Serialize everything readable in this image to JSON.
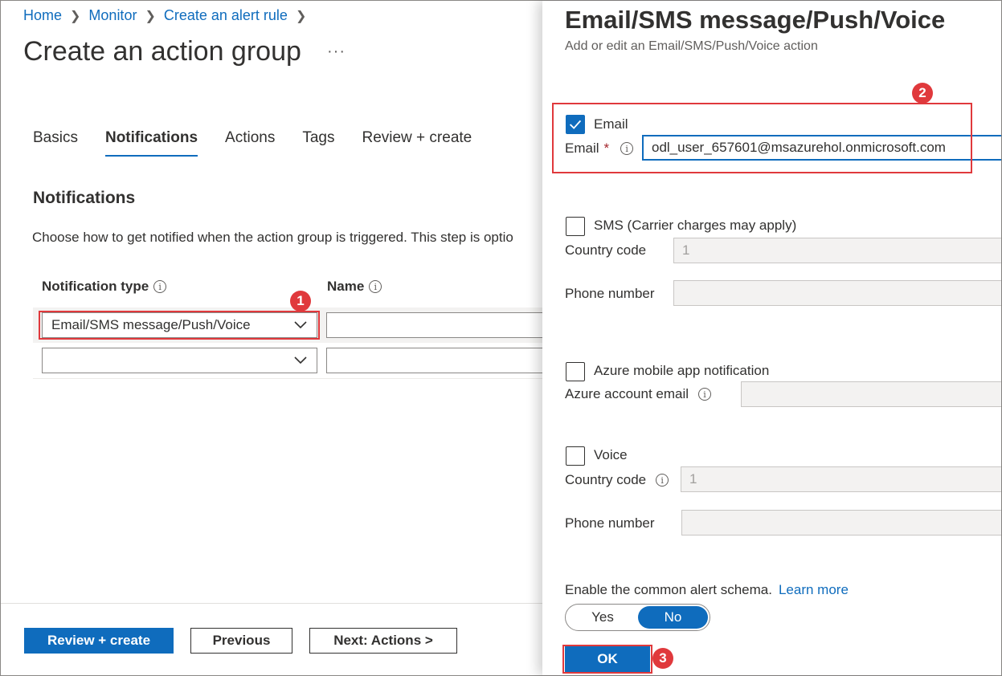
{
  "breadcrumb": [
    {
      "label": "Home"
    },
    {
      "label": "Monitor"
    },
    {
      "label": "Create an alert rule"
    }
  ],
  "page": {
    "title": "Create an action group",
    "more": "···"
  },
  "tabs": [
    {
      "label": "Basics"
    },
    {
      "label": "Notifications",
      "active": true
    },
    {
      "label": "Actions"
    },
    {
      "label": "Tags"
    },
    {
      "label": "Review + create"
    }
  ],
  "notifications": {
    "heading": "Notifications",
    "description": "Choose how to get notified when the action group is triggered. This step is optio",
    "col_type": "Notification type",
    "col_name": "Name",
    "rows": [
      {
        "type": "Email/SMS message/Push/Voice",
        "name": ""
      },
      {
        "type": "",
        "name": ""
      }
    ]
  },
  "footer": {
    "review_create": "Review + create",
    "previous": "Previous",
    "next": "Next: Actions >"
  },
  "panel": {
    "title": "Email/SMS message/Push/Voice",
    "subtitle": "Add or edit an Email/SMS/Push/Voice action",
    "email": {
      "checkbox_label": "Email",
      "checked": true,
      "field_label": "Email",
      "required_mark": "*",
      "value": "odl_user_657601@msazurehol.onmicrosoft.com"
    },
    "sms": {
      "checkbox_label": "SMS (Carrier charges may apply)",
      "checked": false,
      "country_code_label": "Country code",
      "country_code_value": "1",
      "phone_label": "Phone number",
      "phone_value": ""
    },
    "push": {
      "checkbox_label": "Azure mobile app notification",
      "checked": false,
      "account_email_label": "Azure account email",
      "account_email_value": ""
    },
    "voice": {
      "checkbox_label": "Voice",
      "checked": false,
      "country_code_label": "Country code",
      "country_code_value": "1",
      "phone_label": "Phone number",
      "phone_value": ""
    },
    "schema": {
      "label": "Enable the common alert schema.",
      "link": "Learn more",
      "yes": "Yes",
      "no": "No",
      "selected": "No"
    },
    "ok": "OK"
  },
  "annotations": {
    "badge1": "1",
    "badge2": "2",
    "badge3": "3",
    "color": "#e0393c"
  },
  "colors": {
    "accent": "#0f6cbd",
    "text": "#323130",
    "disabled_bg": "#f3f2f1"
  }
}
